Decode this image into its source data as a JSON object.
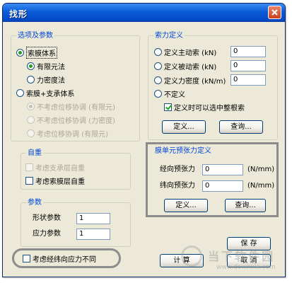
{
  "window": {
    "title": "找形"
  },
  "options": {
    "legend": "选项及参数",
    "cable_membrane": "索膜体系",
    "finite_element": "有限元法",
    "force_density": "力密度法",
    "cable_membrane_support": "索膜+支承体系",
    "disp_opt1": "不考虑位移协调 (有限元)",
    "disp_opt2": "不考虑位移协调 (力密度)",
    "disp_opt3": "考虑位移协调 (有限元)"
  },
  "self_weight": {
    "legend": "自重",
    "support_layer": "考虑支承层自重",
    "cable_layer": "考虑索膜层自重"
  },
  "params": {
    "legend": "参数",
    "shape_label": "形状参数",
    "shape_value": "1",
    "stress_label": "应力参数",
    "stress_value": "1"
  },
  "consider_warp_weft": "考虑经纬向应力不同",
  "cable_force": {
    "legend": "索力定义",
    "active": "定义主动索 (kN)",
    "active_value": "0",
    "passive": "定义被动索 (kN)",
    "passive_value": "0",
    "force_density": "定义力密度 (kN/m)",
    "force_density_value": "0",
    "undefined": "不定义",
    "select_all": "定义时可以选中整根索",
    "define_btn": "定义...",
    "query_btn": "查询..."
  },
  "prestress": {
    "legend": "膜单元预张力定义",
    "warp_label": "经向预张力",
    "warp_value": "0",
    "warp_unit": "(N/mm)",
    "weft_label": "纬向预张力",
    "weft_value": "0",
    "weft_unit": "(N/mm)",
    "define_btn": "定义...",
    "query_btn": "查询..."
  },
  "actions": {
    "save": "保 存",
    "calculate": "计 算",
    "cancel": "取 消"
  },
  "watermark": {
    "text": "当下软件园",
    "url": "www.downxia.com"
  }
}
